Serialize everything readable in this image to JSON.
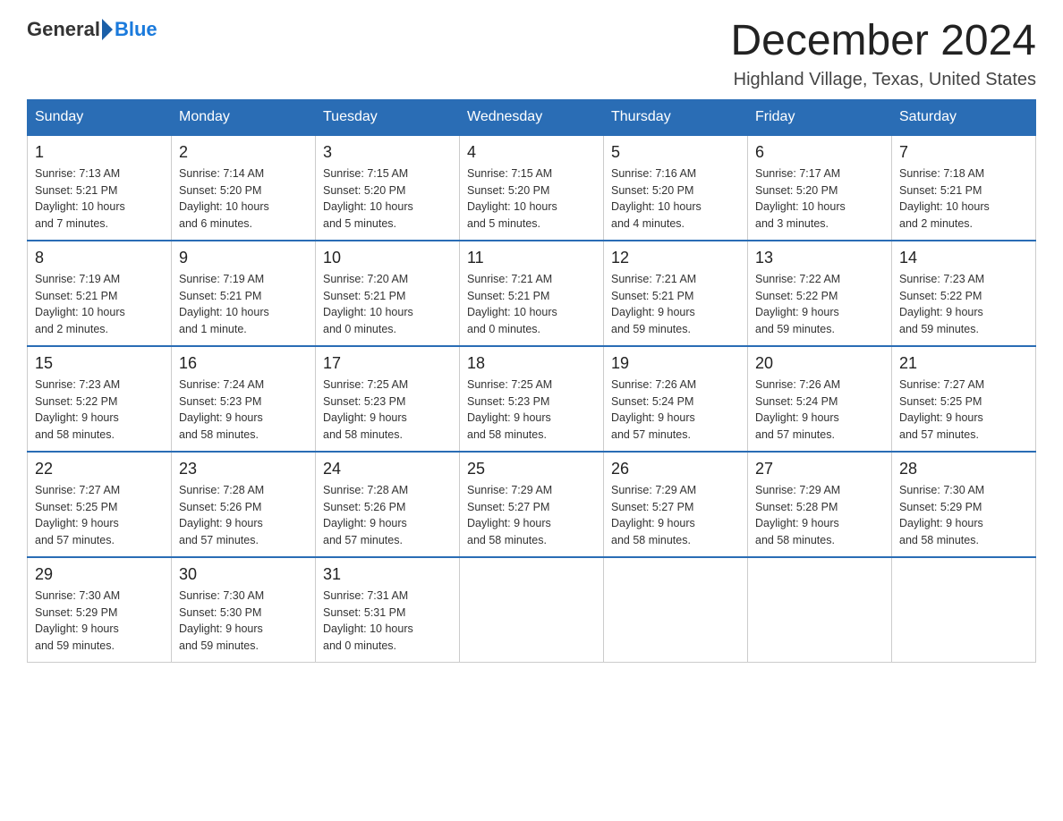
{
  "header": {
    "logo_general": "General",
    "logo_blue": "Blue",
    "main_title": "December 2024",
    "subtitle": "Highland Village, Texas, United States"
  },
  "weekdays": [
    "Sunday",
    "Monday",
    "Tuesday",
    "Wednesday",
    "Thursday",
    "Friday",
    "Saturday"
  ],
  "weeks": [
    [
      {
        "day": "1",
        "info": "Sunrise: 7:13 AM\nSunset: 5:21 PM\nDaylight: 10 hours\nand 7 minutes."
      },
      {
        "day": "2",
        "info": "Sunrise: 7:14 AM\nSunset: 5:20 PM\nDaylight: 10 hours\nand 6 minutes."
      },
      {
        "day": "3",
        "info": "Sunrise: 7:15 AM\nSunset: 5:20 PM\nDaylight: 10 hours\nand 5 minutes."
      },
      {
        "day": "4",
        "info": "Sunrise: 7:15 AM\nSunset: 5:20 PM\nDaylight: 10 hours\nand 5 minutes."
      },
      {
        "day": "5",
        "info": "Sunrise: 7:16 AM\nSunset: 5:20 PM\nDaylight: 10 hours\nand 4 minutes."
      },
      {
        "day": "6",
        "info": "Sunrise: 7:17 AM\nSunset: 5:20 PM\nDaylight: 10 hours\nand 3 minutes."
      },
      {
        "day": "7",
        "info": "Sunrise: 7:18 AM\nSunset: 5:21 PM\nDaylight: 10 hours\nand 2 minutes."
      }
    ],
    [
      {
        "day": "8",
        "info": "Sunrise: 7:19 AM\nSunset: 5:21 PM\nDaylight: 10 hours\nand 2 minutes."
      },
      {
        "day": "9",
        "info": "Sunrise: 7:19 AM\nSunset: 5:21 PM\nDaylight: 10 hours\nand 1 minute."
      },
      {
        "day": "10",
        "info": "Sunrise: 7:20 AM\nSunset: 5:21 PM\nDaylight: 10 hours\nand 0 minutes."
      },
      {
        "day": "11",
        "info": "Sunrise: 7:21 AM\nSunset: 5:21 PM\nDaylight: 10 hours\nand 0 minutes."
      },
      {
        "day": "12",
        "info": "Sunrise: 7:21 AM\nSunset: 5:21 PM\nDaylight: 9 hours\nand 59 minutes."
      },
      {
        "day": "13",
        "info": "Sunrise: 7:22 AM\nSunset: 5:22 PM\nDaylight: 9 hours\nand 59 minutes."
      },
      {
        "day": "14",
        "info": "Sunrise: 7:23 AM\nSunset: 5:22 PM\nDaylight: 9 hours\nand 59 minutes."
      }
    ],
    [
      {
        "day": "15",
        "info": "Sunrise: 7:23 AM\nSunset: 5:22 PM\nDaylight: 9 hours\nand 58 minutes."
      },
      {
        "day": "16",
        "info": "Sunrise: 7:24 AM\nSunset: 5:23 PM\nDaylight: 9 hours\nand 58 minutes."
      },
      {
        "day": "17",
        "info": "Sunrise: 7:25 AM\nSunset: 5:23 PM\nDaylight: 9 hours\nand 58 minutes."
      },
      {
        "day": "18",
        "info": "Sunrise: 7:25 AM\nSunset: 5:23 PM\nDaylight: 9 hours\nand 58 minutes."
      },
      {
        "day": "19",
        "info": "Sunrise: 7:26 AM\nSunset: 5:24 PM\nDaylight: 9 hours\nand 57 minutes."
      },
      {
        "day": "20",
        "info": "Sunrise: 7:26 AM\nSunset: 5:24 PM\nDaylight: 9 hours\nand 57 minutes."
      },
      {
        "day": "21",
        "info": "Sunrise: 7:27 AM\nSunset: 5:25 PM\nDaylight: 9 hours\nand 57 minutes."
      }
    ],
    [
      {
        "day": "22",
        "info": "Sunrise: 7:27 AM\nSunset: 5:25 PM\nDaylight: 9 hours\nand 57 minutes."
      },
      {
        "day": "23",
        "info": "Sunrise: 7:28 AM\nSunset: 5:26 PM\nDaylight: 9 hours\nand 57 minutes."
      },
      {
        "day": "24",
        "info": "Sunrise: 7:28 AM\nSunset: 5:26 PM\nDaylight: 9 hours\nand 57 minutes."
      },
      {
        "day": "25",
        "info": "Sunrise: 7:29 AM\nSunset: 5:27 PM\nDaylight: 9 hours\nand 58 minutes."
      },
      {
        "day": "26",
        "info": "Sunrise: 7:29 AM\nSunset: 5:27 PM\nDaylight: 9 hours\nand 58 minutes."
      },
      {
        "day": "27",
        "info": "Sunrise: 7:29 AM\nSunset: 5:28 PM\nDaylight: 9 hours\nand 58 minutes."
      },
      {
        "day": "28",
        "info": "Sunrise: 7:30 AM\nSunset: 5:29 PM\nDaylight: 9 hours\nand 58 minutes."
      }
    ],
    [
      {
        "day": "29",
        "info": "Sunrise: 7:30 AM\nSunset: 5:29 PM\nDaylight: 9 hours\nand 59 minutes."
      },
      {
        "day": "30",
        "info": "Sunrise: 7:30 AM\nSunset: 5:30 PM\nDaylight: 9 hours\nand 59 minutes."
      },
      {
        "day": "31",
        "info": "Sunrise: 7:31 AM\nSunset: 5:31 PM\nDaylight: 10 hours\nand 0 minutes."
      },
      null,
      null,
      null,
      null
    ]
  ]
}
